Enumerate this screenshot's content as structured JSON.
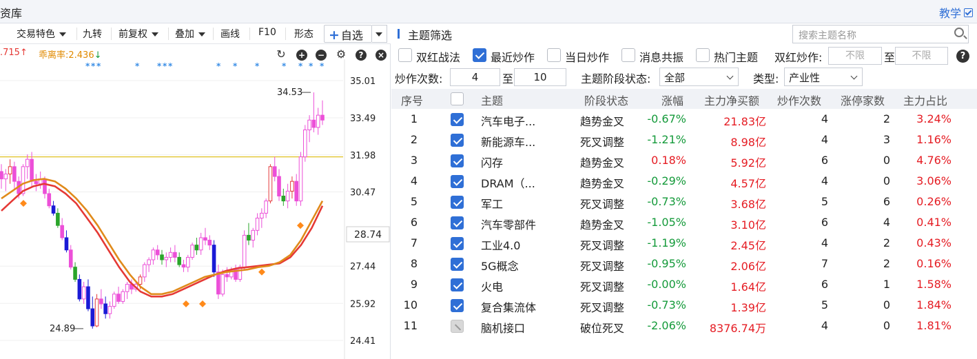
{
  "topbar": {
    "title": "资库",
    "teach": "教学"
  },
  "toolbar": {
    "items": [
      "交易特色",
      "九转",
      "前复权",
      "叠加",
      "画线",
      "F10",
      "形态"
    ],
    "self_select": "自选"
  },
  "indicators": {
    "value1": ".715",
    "value2": "乖离率:2.436"
  },
  "chart_data": {
    "type": "candlestick",
    "y_ticks": [
      "35.01",
      "33.49",
      "31.98",
      "30.47",
      "28.74",
      "27.44",
      "25.92",
      "24.41"
    ],
    "current_price": "28.74",
    "reference_line": 31.9,
    "high_label": "34.53",
    "low_label": "24.89",
    "ylim": [
      24.41,
      35.01
    ],
    "candles": [
      [
        31.3,
        31.6,
        30.6,
        31.0
      ],
      [
        31.0,
        31.4,
        30.5,
        31.2
      ],
      [
        31.2,
        31.8,
        30.8,
        31.5
      ],
      [
        31.5,
        31.7,
        30.6,
        30.9
      ],
      [
        30.9,
        31.1,
        30.2,
        30.4
      ],
      [
        30.4,
        31.6,
        30.3,
        31.5
      ],
      [
        31.5,
        32.0,
        31.0,
        31.8
      ],
      [
        31.8,
        32.1,
        30.7,
        30.9
      ],
      [
        30.9,
        31.2,
        30.5,
        30.8
      ],
      [
        30.8,
        31.3,
        30.6,
        31.0
      ],
      [
        31.0,
        31.1,
        30.2,
        30.4
      ],
      [
        30.4,
        30.6,
        29.8,
        29.9
      ],
      [
        29.9,
        30.1,
        29.5,
        29.6
      ],
      [
        29.6,
        29.8,
        29.0,
        29.1
      ],
      [
        29.1,
        29.4,
        28.5,
        28.6
      ],
      [
        28.6,
        28.9,
        28.0,
        28.1
      ],
      [
        28.1,
        28.3,
        27.3,
        27.4
      ],
      [
        27.4,
        27.6,
        26.8,
        26.9
      ],
      [
        26.9,
        27.1,
        26.0,
        26.1
      ],
      [
        26.1,
        26.8,
        25.9,
        26.6
      ],
      [
        26.6,
        26.9,
        25.6,
        25.7
      ],
      [
        25.7,
        26.2,
        24.89,
        25.0
      ],
      [
        25.0,
        26.3,
        24.95,
        26.1
      ],
      [
        26.1,
        26.5,
        25.7,
        25.9
      ],
      [
        25.9,
        26.2,
        25.3,
        25.5
      ],
      [
        25.5,
        26.0,
        25.3,
        25.8
      ],
      [
        25.8,
        26.4,
        25.7,
        26.3
      ],
      [
        26.3,
        26.6,
        25.9,
        26.0
      ],
      [
        26.0,
        26.5,
        25.9,
        26.4
      ],
      [
        26.4,
        26.8,
        26.1,
        26.7
      ],
      [
        26.7,
        26.9,
        26.3,
        26.5
      ],
      [
        26.5,
        26.8,
        26.4,
        26.7
      ],
      [
        26.7,
        27.1,
        26.5,
        27.0
      ],
      [
        27.0,
        27.6,
        26.8,
        27.5
      ],
      [
        27.5,
        27.8,
        27.2,
        27.7
      ],
      [
        27.7,
        28.2,
        27.5,
        28.1
      ],
      [
        28.1,
        28.3,
        27.7,
        27.9
      ],
      [
        27.9,
        28.1,
        27.5,
        27.7
      ],
      [
        27.7,
        28.0,
        27.4,
        27.8
      ],
      [
        27.8,
        28.2,
        27.6,
        28.0
      ],
      [
        28.0,
        28.3,
        27.6,
        27.8
      ],
      [
        27.8,
        28.0,
        27.4,
        27.5
      ],
      [
        27.5,
        27.7,
        27.2,
        27.4
      ],
      [
        27.4,
        27.9,
        27.2,
        27.8
      ],
      [
        27.8,
        28.4,
        27.7,
        28.3
      ],
      [
        28.3,
        28.6,
        27.9,
        28.1
      ],
      [
        28.1,
        28.8,
        27.9,
        28.6
      ],
      [
        28.6,
        29.0,
        28.3,
        28.5
      ],
      [
        28.5,
        28.7,
        28.1,
        28.3
      ],
      [
        28.3,
        28.5,
        27.0,
        27.2
      ],
      [
        27.2,
        27.5,
        26.1,
        26.3
      ],
      [
        26.3,
        27.3,
        26.2,
        27.1
      ],
      [
        27.1,
        27.4,
        26.8,
        27.0
      ],
      [
        27.0,
        27.4,
        26.9,
        27.3
      ],
      [
        27.3,
        27.5,
        26.8,
        26.9
      ],
      [
        26.9,
        27.5,
        26.8,
        27.4
      ],
      [
        27.4,
        28.9,
        27.3,
        28.7
      ],
      [
        28.7,
        29.2,
        28.3,
        28.5
      ],
      [
        28.5,
        29.0,
        28.2,
        28.9
      ],
      [
        28.9,
        29.6,
        28.7,
        29.4
      ],
      [
        29.4,
        29.8,
        29.0,
        29.6
      ],
      [
        29.6,
        30.2,
        29.4,
        30.1
      ],
      [
        30.1,
        31.6,
        30.0,
        31.5
      ],
      [
        31.5,
        31.9,
        30.9,
        31.1
      ],
      [
        31.1,
        31.4,
        30.1,
        30.3
      ],
      [
        30.3,
        30.6,
        29.9,
        30.1
      ],
      [
        30.1,
        30.8,
        29.8,
        30.5
      ],
      [
        30.5,
        31.1,
        30.2,
        30.9
      ],
      [
        30.9,
        31.2,
        29.9,
        30.1
      ],
      [
        30.1,
        32.1,
        29.9,
        31.9
      ],
      [
        31.9,
        33.2,
        31.7,
        33.0
      ],
      [
        33.0,
        33.6,
        32.5,
        33.4
      ],
      [
        33.4,
        34.53,
        32.9,
        33.1
      ],
      [
        33.1,
        33.9,
        32.8,
        33.6
      ],
      [
        33.6,
        34.2,
        33.2,
        33.4
      ]
    ],
    "ma_orange": [
      30.2,
      30.5,
      30.8,
      30.95,
      31.0,
      30.9,
      30.6,
      30.2,
      29.7,
      29.1,
      28.4,
      27.7,
      27.1,
      26.6,
      26.3,
      26.3,
      26.4,
      26.6,
      26.8,
      27.0,
      27.1,
      27.2,
      27.25,
      27.3,
      27.4,
      27.45,
      27.6,
      27.9,
      28.5,
      29.3,
      30.1
    ],
    "ma_red": [
      29.7,
      30.1,
      30.5,
      30.7,
      30.8,
      30.7,
      30.4,
      30.0,
      29.4,
      28.8,
      28.1,
      27.4,
      26.8,
      26.4,
      26.2,
      26.2,
      26.3,
      26.5,
      26.7,
      26.9,
      27.1,
      27.25,
      27.35,
      27.4,
      27.45,
      27.5,
      27.55,
      27.8,
      28.3,
      29.0,
      29.9
    ]
  },
  "panel": {
    "title": "主题筛选",
    "search_placeholder": "搜索主题名称",
    "filters": {
      "shuanghong": "双红战法",
      "recent": "最近炒作",
      "today": "当日炒作",
      "news": "消息共振",
      "hot": "热门主题",
      "shuanghong_label": "双红炒作:",
      "unlimited1": "不限",
      "to": "至",
      "unlimited2": "不限",
      "count_label": "炒作次数:",
      "count_from": "4",
      "count_to": "10",
      "stage_label": "主题阶段状态:",
      "stage_value": "全部",
      "type_label": "类型:",
      "type_value": "产业性"
    },
    "columns": [
      "序号",
      "主题",
      "阶段状态",
      "涨幅",
      "主力净买额",
      "炒作次数",
      "涨停家数",
      "主力占比"
    ],
    "rows": [
      {
        "no": "1",
        "name": "汽车电子...",
        "stage": "趋势金叉",
        "chg": "-0.67%",
        "net": "21.83亿",
        "count": "4",
        "limit": "2",
        "ratio": "3.24%",
        "checked": true
      },
      {
        "no": "2",
        "name": "新能源车...",
        "stage": "死叉调整",
        "chg": "-1.21%",
        "net": "8.98亿",
        "count": "4",
        "limit": "3",
        "ratio": "1.16%",
        "checked": true
      },
      {
        "no": "3",
        "name": "闪存",
        "stage": "趋势金叉",
        "chg": "0.18%",
        "net": "5.92亿",
        "count": "6",
        "limit": "0",
        "ratio": "4.76%",
        "checked": true
      },
      {
        "no": "4",
        "name": "DRAM（...",
        "stage": "趋势金叉",
        "chg": "-0.29%",
        "net": "4.57亿",
        "count": "4",
        "limit": "0",
        "ratio": "3.06%",
        "checked": true
      },
      {
        "no": "5",
        "name": "军工",
        "stage": "死叉调整",
        "chg": "-0.73%",
        "net": "3.68亿",
        "count": "5",
        "limit": "6",
        "ratio": "0.26%",
        "checked": true
      },
      {
        "no": "6",
        "name": "汽车零部件",
        "stage": "趋势金叉",
        "chg": "-1.05%",
        "net": "3.10亿",
        "count": "6",
        "limit": "4",
        "ratio": "0.41%",
        "checked": true
      },
      {
        "no": "7",
        "name": "工业4.0",
        "stage": "死叉调整",
        "chg": "-1.19%",
        "net": "2.45亿",
        "count": "4",
        "limit": "2",
        "ratio": "0.43%",
        "checked": true
      },
      {
        "no": "8",
        "name": "5G概念",
        "stage": "死叉调整",
        "chg": "-0.95%",
        "net": "2.06亿",
        "count": "7",
        "limit": "2",
        "ratio": "0.16%",
        "checked": true
      },
      {
        "no": "9",
        "name": "火电",
        "stage": "死叉调整",
        "chg": "-0.00%",
        "net": "1.64亿",
        "count": "6",
        "limit": "1",
        "ratio": "1.58%",
        "checked": true
      },
      {
        "no": "10",
        "name": "复合集流体",
        "stage": "死叉调整",
        "chg": "-0.73%",
        "net": "1.39亿",
        "count": "5",
        "limit": "0",
        "ratio": "1.84%",
        "checked": true
      },
      {
        "no": "11",
        "name": "脑机接口",
        "stage": "破位死叉",
        "chg": "-2.06%",
        "net": "8376.74万",
        "count": "4",
        "limit": "0",
        "ratio": "1.81%",
        "checked": false
      }
    ]
  }
}
